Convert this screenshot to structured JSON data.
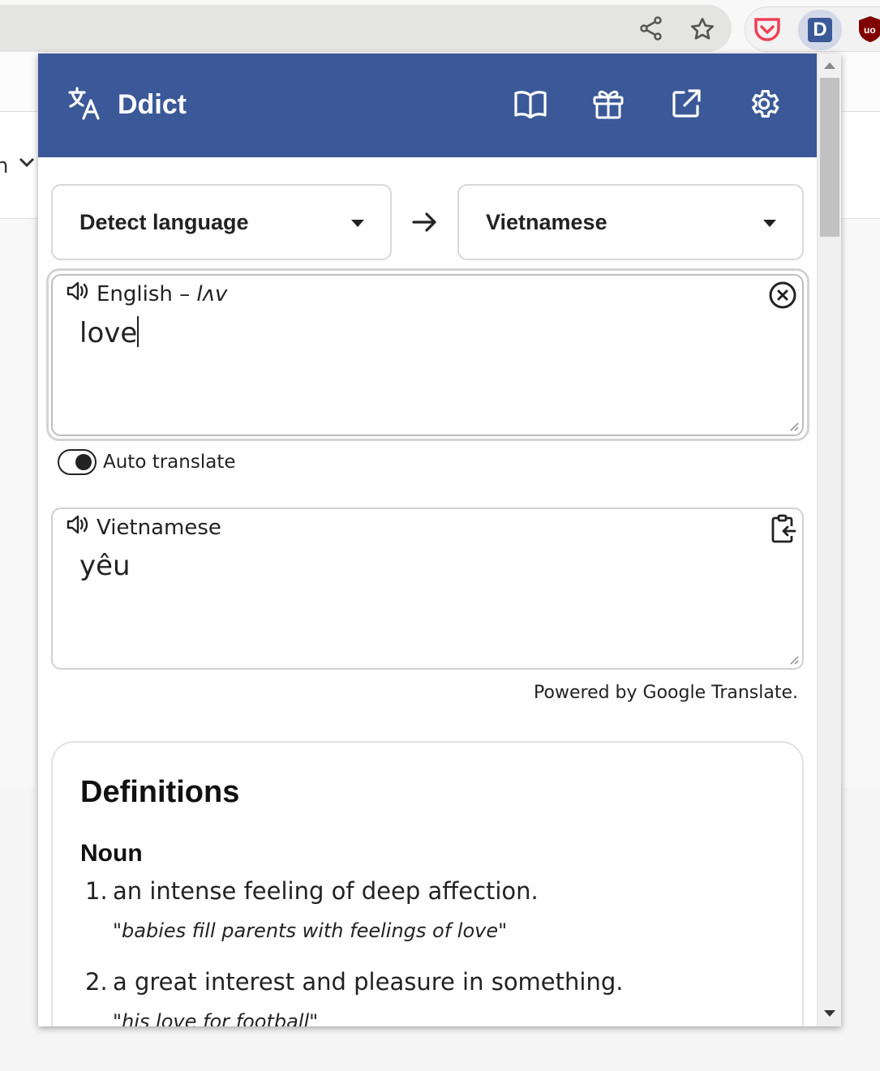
{
  "app": {
    "name": "Ddict"
  },
  "header": {
    "buttons": [
      {
        "name": "dictionary",
        "icon": "book-icon"
      },
      {
        "name": "gift",
        "icon": "gift-icon"
      },
      {
        "name": "open-in-new",
        "icon": "external-link-icon"
      },
      {
        "name": "settings",
        "icon": "gear-icon"
      }
    ],
    "color": "#3b5998"
  },
  "languages": {
    "source": "Detect language",
    "target": "Vietnamese"
  },
  "source": {
    "label": "English – ",
    "phonetic": "lʌv",
    "text": "love"
  },
  "auto_translate": {
    "label": "Auto translate",
    "enabled": true
  },
  "output": {
    "label": "Vietnamese",
    "text": "yêu"
  },
  "powered_by": "Powered by Google Translate.",
  "definitions": {
    "title": "Definitions",
    "part_of_speech": "Noun",
    "items": [
      {
        "num": "1.",
        "text": "an intense feeling of deep affection.",
        "example": "\"babies fill parents with feelings of love\""
      },
      {
        "num": "2.",
        "text": "a great interest and pleasure in something.",
        "example": "\"his love for football\""
      }
    ]
  },
  "browser": {
    "address_bar_left_text": "n"
  }
}
